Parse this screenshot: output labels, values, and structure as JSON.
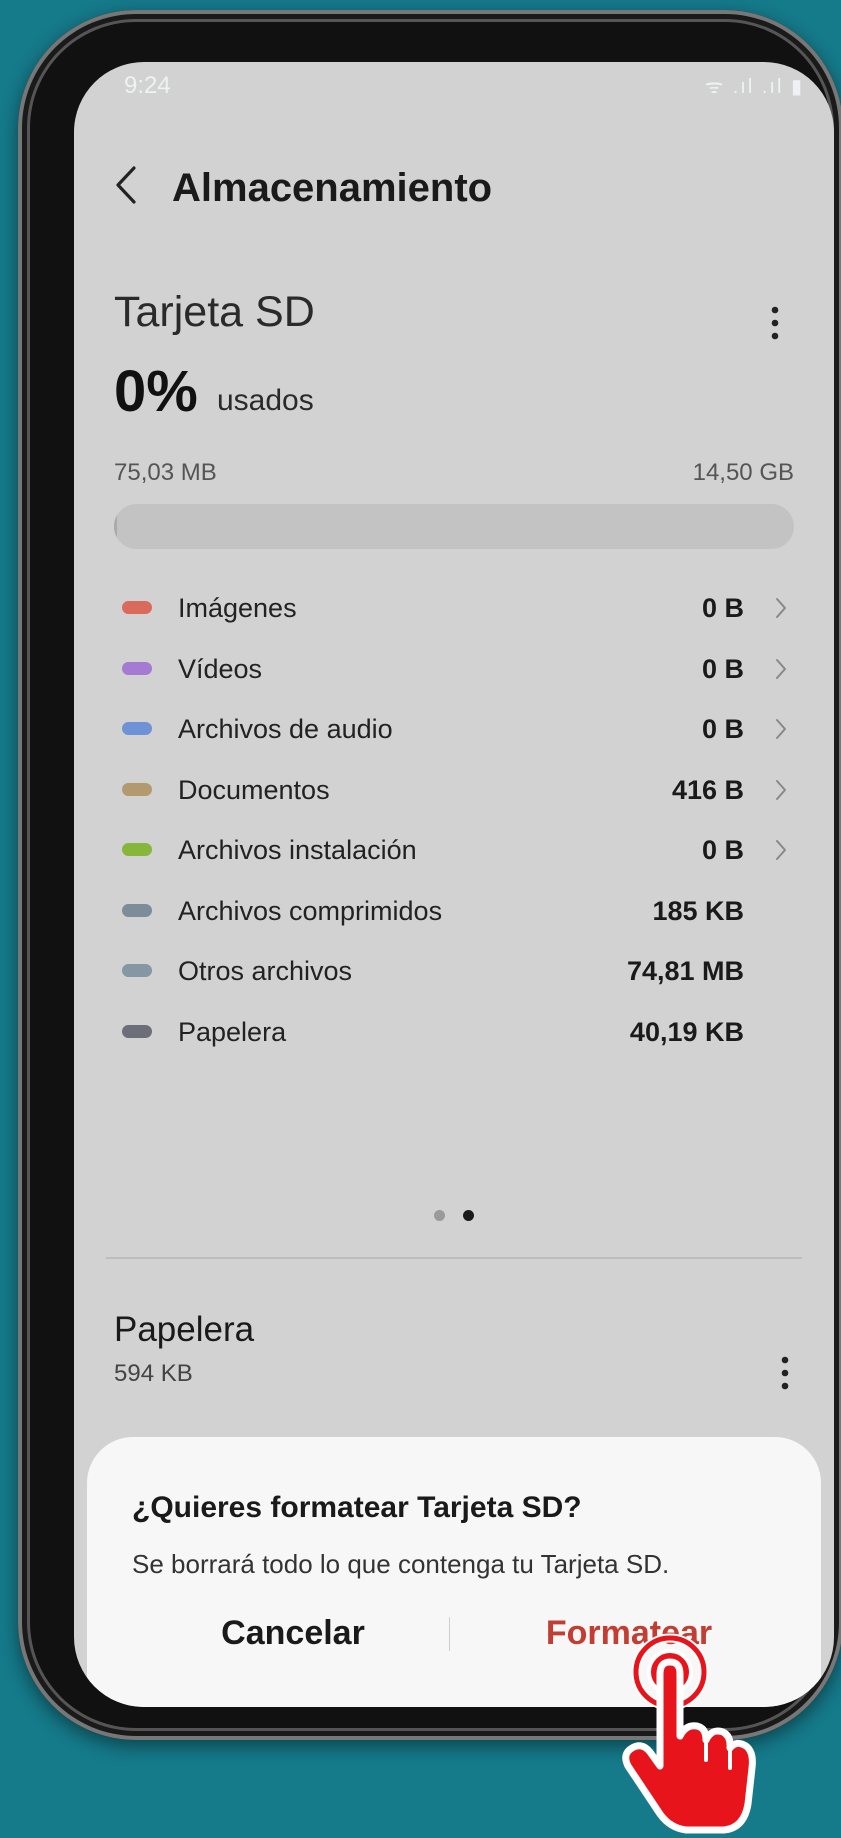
{
  "status_bar": {
    "time": "9:24",
    "icons": "ᯤ .ıl .ıl ▮"
  },
  "header": {
    "title": "Almacenamiento"
  },
  "storage": {
    "name": "Tarjeta SD",
    "percent": "0%",
    "percent_suffix": "usados",
    "used": "75,03 MB",
    "total": "14,50 GB",
    "usage_fraction": 0.005
  },
  "categories": [
    {
      "label": "Imágenes",
      "value": "0 B",
      "color": "#d96a5c",
      "has_chevron": true
    },
    {
      "label": "Vídeos",
      "value": "0 B",
      "color": "#a57ad3",
      "has_chevron": true
    },
    {
      "label": "Archivos de audio",
      "value": "0 B",
      "color": "#6f92d6",
      "has_chevron": true
    },
    {
      "label": "Documentos",
      "value": "416 B",
      "color": "#b39a6e",
      "has_chevron": true
    },
    {
      "label": "Archivos instalación",
      "value": "0 B",
      "color": "#86b73b",
      "has_chevron": true
    },
    {
      "label": "Archivos comprimidos",
      "value": "185 KB",
      "color": "#7c8c98",
      "has_chevron": false
    },
    {
      "label": "Otros archivos",
      "value": "74,81 MB",
      "color": "#8597a2",
      "has_chevron": false
    },
    {
      "label": "Papelera",
      "value": "40,19 KB",
      "color": "#6c6f78",
      "has_chevron": false
    }
  ],
  "pager": {
    "count": 2,
    "active": 1
  },
  "trash": {
    "title": "Papelera",
    "size": "594 KB"
  },
  "dialog": {
    "title": "¿Quieres formatear Tarjeta SD?",
    "message": "Se borrará todo lo que contenga tu Tarjeta SD.",
    "cancel_label": "Cancelar",
    "confirm_label": "Formatear"
  },
  "colors": {
    "accent_destructive": "#c23d32",
    "background": "#157a8a",
    "hand": "#e8141c"
  }
}
